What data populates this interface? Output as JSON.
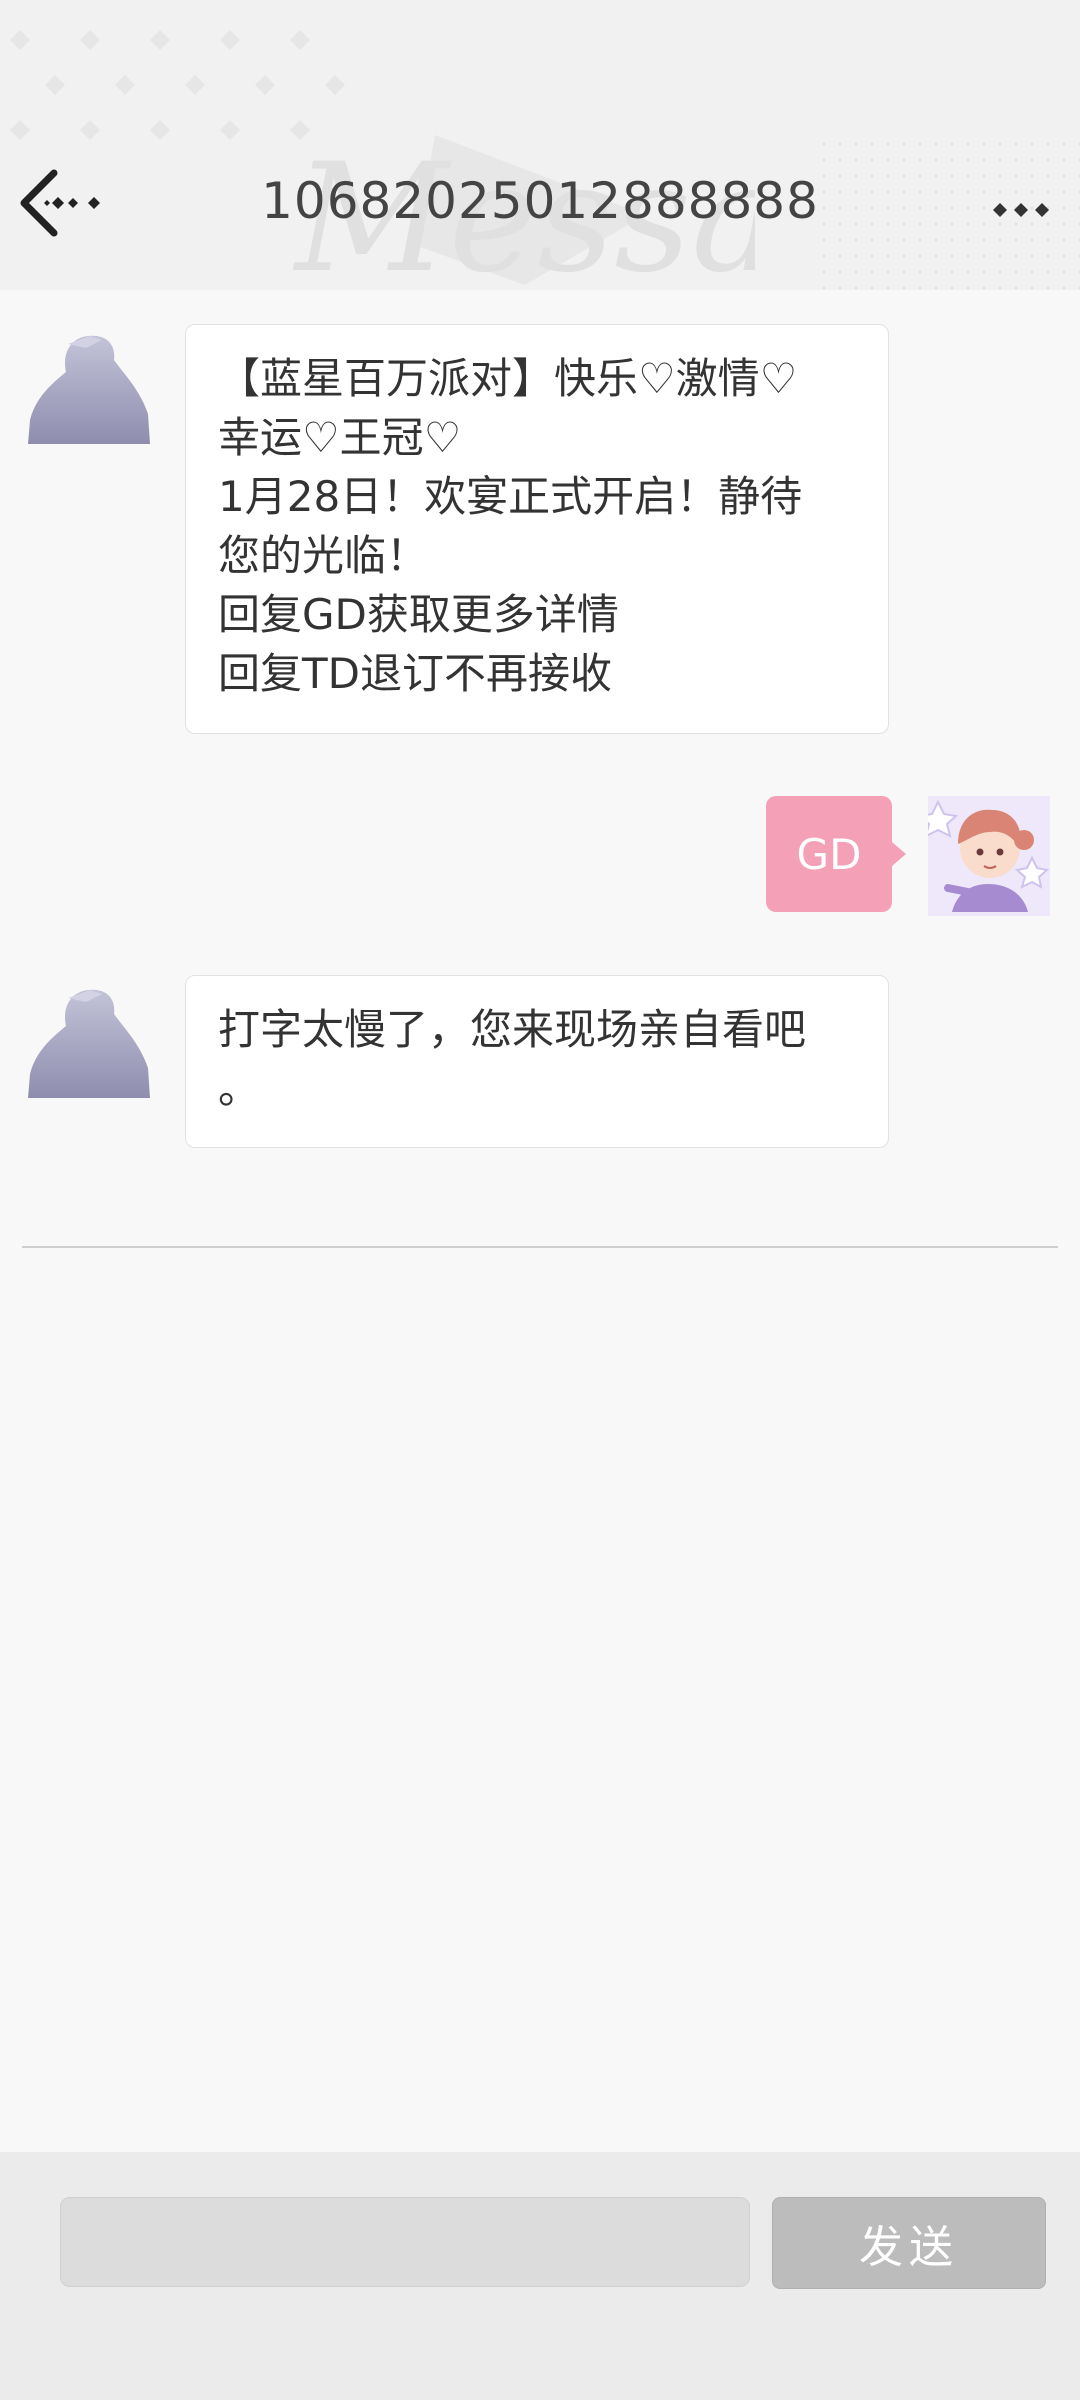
{
  "header": {
    "title": "10682025012888888",
    "watermark": "Message",
    "back_icon": "back-arrow-icon",
    "more_icon": "more-dots-icon"
  },
  "messages": [
    {
      "direction": "incoming",
      "avatar": "silhouette-avatar",
      "text": "【蓝星百万派对】快乐♡激情♡\n幸运♡王冠♡\n1月28日！欢宴正式开启！静待\n您的光临！\n回复GD获取更多详情\n回复TD退订不再接收"
    },
    {
      "direction": "outgoing",
      "avatar": "user-avatar",
      "text": "GD"
    },
    {
      "direction": "incoming",
      "avatar": "silhouette-avatar",
      "text": "打字太慢了，您来现场亲自看吧\n。"
    }
  ],
  "composer": {
    "input_value": "",
    "placeholder": "",
    "send_label": "发送"
  },
  "colors": {
    "outgoing_bubble": "#f4a1b8",
    "send_button": "#bcbcbc",
    "header_bg": "#f1f1f1"
  }
}
